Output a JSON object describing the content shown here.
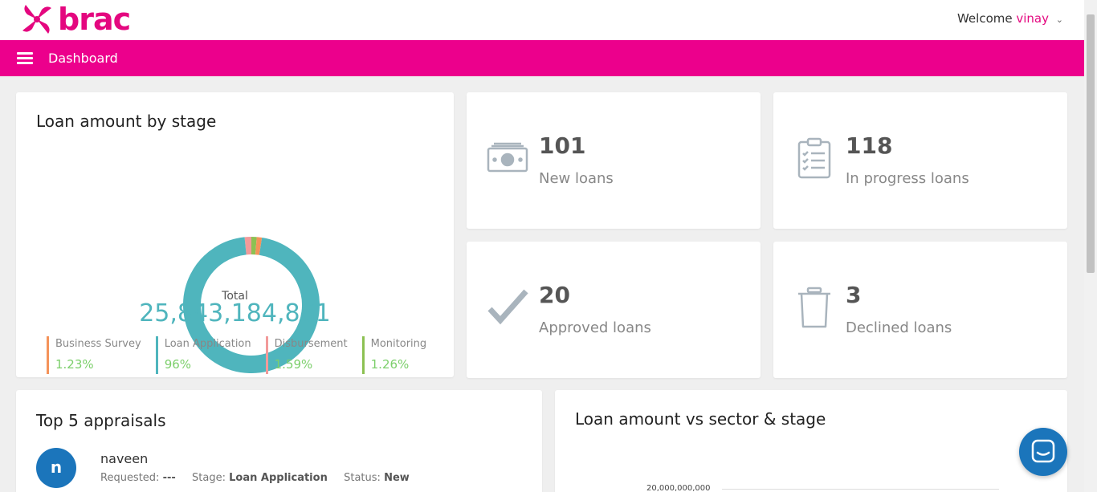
{
  "header": {
    "logo_text": "brac",
    "welcome_label": "Welcome",
    "user_name": "vinay"
  },
  "nav": {
    "title": "Dashboard"
  },
  "loan_by_stage": {
    "title": "Loan amount by stage",
    "total_label": "Total",
    "total_value": "25,843,184,861",
    "chart_data": {
      "type": "pie",
      "title": "Loan amount by stage",
      "categories": [
        "Business Survey",
        "Loan Application",
        "Disbursement",
        "Monitoring"
      ],
      "values": [
        1.23,
        96,
        1.59,
        1.26
      ],
      "colors": [
        "#f4935a",
        "#4fb5bd",
        "#f29a9a",
        "#8cc152"
      ]
    },
    "legend": [
      {
        "name": "Business Survey",
        "pct": "1.23%",
        "color": "#f4935a"
      },
      {
        "name": "Loan Application",
        "pct": "96%",
        "color": "#4fb5bd"
      },
      {
        "name": "Disbursement",
        "pct": "1.59%",
        "color": "#f29a9a"
      },
      {
        "name": "Monitoring",
        "pct": "1.26%",
        "color": "#8cc152"
      }
    ]
  },
  "stats": {
    "new": {
      "value": "101",
      "label": "New loans",
      "icon": "money-icon"
    },
    "in_progress": {
      "value": "118",
      "label": "In progress loans",
      "icon": "clipboard-checklist-icon"
    },
    "approved": {
      "value": "20",
      "label": "Approved loans",
      "icon": "checkmark-icon"
    },
    "declined": {
      "value": "3",
      "label": "Declined loans",
      "icon": "trash-icon"
    }
  },
  "appraisals": {
    "title": "Top 5 appraisals",
    "items": [
      {
        "initial": "n",
        "name": "naveen",
        "requested_label": "Requested:",
        "requested_value": "---",
        "stage_label": "Stage:",
        "stage_value": "Loan Application",
        "status_label": "Status:",
        "status_value": "New"
      }
    ]
  },
  "sector_chart": {
    "title": "Loan amount vs sector & stage",
    "visible_tick": "20,000,000,000"
  },
  "colors": {
    "brand": "#ec008c",
    "accent_teal": "#4fb5bd",
    "avatar_blue": "#1b75bb"
  }
}
